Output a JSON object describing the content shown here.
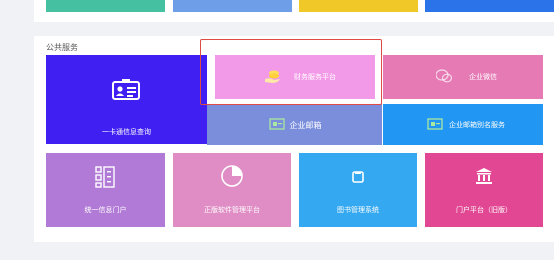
{
  "section": {
    "title": "公共服务"
  },
  "top_row_colors": [
    "#45c0a0",
    "#6f9ee8",
    "#f0c928",
    "#2a73e8"
  ],
  "tiles": {
    "card_query": {
      "label": "一卡通信息查询",
      "color": "#3f1ff2",
      "icon": "id-card-icon"
    },
    "finance": {
      "label": "财务服务平台",
      "color": "#f29ae8",
      "icon": "coins-hand-icon"
    },
    "enterprise_wechat": {
      "label": "企业微信",
      "color": "#e57ab4",
      "icon": "wechat-icon"
    },
    "enterprise_mail": {
      "label": "企业邮箱",
      "color": "#7b8edb",
      "icon": "mail-icon"
    },
    "mail_alias": {
      "label": "企业邮箱别名服务",
      "color": "#2196f3",
      "icon": "mail-alias-icon"
    },
    "portal": {
      "label": "统一信息门户",
      "color": "#b17ad6",
      "icon": "grid-icon"
    },
    "software": {
      "label": "正版软件管理平台",
      "color": "#df8dc4",
      "icon": "pie-icon"
    },
    "library": {
      "label": "图书管理系统",
      "color": "#34a8f0",
      "icon": "book-icon"
    },
    "portal_old": {
      "label": "门户平台（旧版）",
      "color": "#e14793",
      "icon": "building-icon"
    }
  },
  "highlight_color": "#e04a45"
}
